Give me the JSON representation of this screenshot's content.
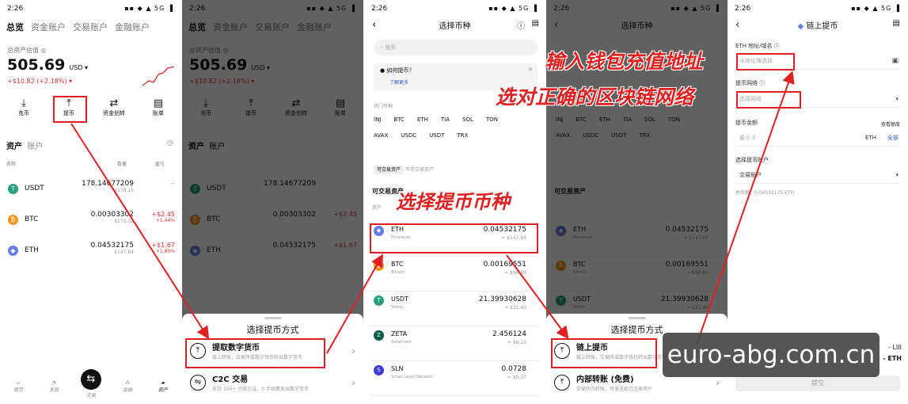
{
  "status": {
    "time": "2:26",
    "icons": "▪▪ ◆ ▲ 5G ▐"
  },
  "p1": {
    "tabs": [
      "总览",
      "资金账户",
      "交易账户",
      "金融账户"
    ],
    "est_label": "总资产估值 ◎",
    "total": "505.69",
    "unit": "USD ▾",
    "change": "+$10.82 (+2.18%) ▾",
    "actions": [
      {
        "label": "充币",
        "icon": "⤓"
      },
      {
        "label": "提币",
        "icon": "⤒"
      },
      {
        "label": "资金划转",
        "icon": "⇄"
      },
      {
        "label": "账单",
        "icon": "▤"
      }
    ],
    "asset_tabs": [
      "资产",
      "账户"
    ],
    "col_headers": [
      "名称",
      "数量",
      "盈亏"
    ],
    "coins": [
      {
        "sym": "USDT",
        "amt": "178.14677209",
        "sub": "$178.15",
        "pnl": "--",
        "pct": "",
        "color": "#26a17b",
        "g": "T"
      },
      {
        "sym": "BTC",
        "amt": "0.00303302",
        "sub": "$173.32",
        "pnl": "+$2.45",
        "pct": "+1.44%",
        "color": "#f7931a",
        "g": "₿"
      },
      {
        "sym": "ETH",
        "amt": "0.04532175",
        "sub": "$147.64",
        "pnl": "+$1.67",
        "pct": "+1.60%",
        "color": "#627eea",
        "g": "◆"
      }
    ],
    "nav": [
      "首页",
      "发现",
      "交易",
      "金融",
      "资产"
    ]
  },
  "p2": {
    "sheet_title": "选择提币方式",
    "opt1_title": "提取数字货币",
    "opt1_desc": "链上转账，交易所或数字钱包转出数字货币",
    "opt2_title": "C2C 交易",
    "opt2_desc": "支持 100+ 付款方式，0 手续费卖出数字货币"
  },
  "p3": {
    "title": "选择币种",
    "search_placeholder": "搜索",
    "notice_title": "如何提币？",
    "notice_link": "了解更多",
    "popular_label": "热门币种",
    "chips1": [
      "INJ",
      "BTC",
      "ETH",
      "TIA",
      "SOL",
      "TON"
    ],
    "chips2": [
      "AVAX",
      "USDC",
      "USDT",
      "TRX"
    ],
    "filter_tabs": [
      "可交易资产",
      "不可交易资产"
    ],
    "section": "可交易资产",
    "list_header": "资产",
    "coins": [
      {
        "sym": "ETH",
        "name": "Ethereum",
        "amt": "0.04532175",
        "usd": "≈ $147.64",
        "color": "#627eea",
        "g": "◆"
      },
      {
        "sym": "BTC",
        "name": "Bitcoin",
        "amt": "0.00169551",
        "usd": "≈ $96.89",
        "color": "#f7931a",
        "g": "₿"
      },
      {
        "sym": "USDT",
        "name": "Tether",
        "amt": "21.39930628",
        "usd": "≈ $21.40",
        "color": "#26a17b",
        "g": "T"
      },
      {
        "sym": "ZETA",
        "name": "ZetaChain",
        "amt": "2.456124",
        "usd": "≈ $6.23",
        "color": "#0a5c4a",
        "g": "Z"
      },
      {
        "sym": "SLN",
        "name": "Smart Layer Network",
        "amt": "0.0728",
        "usd": "≈ $0.37",
        "color": "#3b3bd6",
        "g": "S"
      }
    ]
  },
  "p4": {
    "sheet_title": "选择提币方式",
    "opt1_title": "链上提币",
    "opt1_desc": "链上转账，交易所或数字钱包转出数字货币",
    "opt2_title": "内部转账 (免费)",
    "opt2_desc": "交易所内转账，可发送给已注册用户"
  },
  "p5": {
    "title": "链上提币",
    "coin": "ETH",
    "addr_label": "ETH 地址/域名 ⓘ",
    "addr_placeholder": "从地址簿选择",
    "net_label": "提币网络 ⓘ",
    "net_placeholder": "选择网络",
    "amt_label": "提币金额",
    "amt_hint": "查看额度",
    "amt_placeholder": "最小 0",
    "amt_unit": "ETH",
    "amt_all": "全部",
    "from_label": "选择提币账户",
    "from_value": "交易账户",
    "avail": "总余额：0.04532175 ETH",
    "fee_line1": "- LIII",
    "fee_line2": "- ETH",
    "submit": "提交"
  },
  "captions": {
    "c1": "输入钱包充值地址",
    "c2": "选对正确的区块链网络",
    "c3": "选择提币币种"
  },
  "watermark": "euro-abg.com.cn"
}
